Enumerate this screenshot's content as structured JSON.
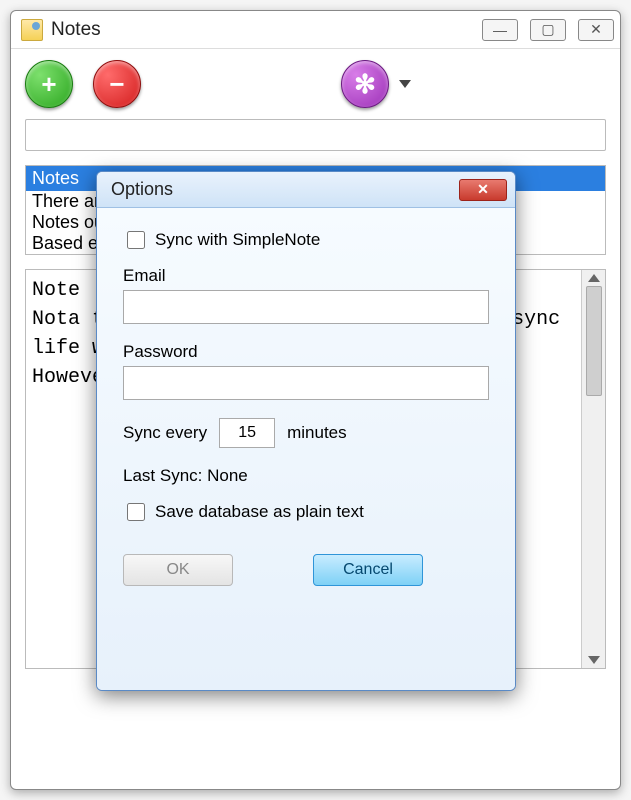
{
  "window": {
    "title": "Notes"
  },
  "toolbar": {
    "add_icon": "+",
    "remove_icon": "−",
    "gear_icon": "✻"
  },
  "search": {
    "value": ""
  },
  "notes_list": {
    "selected_title": "Notes",
    "lines": [
      "There are few t",
      "Notes our no",
      "Based esigne"
    ]
  },
  "note_body": "Note\nNota to m much down Simp my i Then Velo sync\nlife was simplified.\nHowever, at work I am still trapped in",
  "dialog": {
    "title": "Options",
    "sync_checkbox_label": "Sync with SimpleNote",
    "sync_checked": false,
    "email_label": "Email",
    "email_value": "",
    "password_label": "Password",
    "password_value": "",
    "sync_every_label": "Sync every",
    "sync_interval": "15",
    "sync_minutes_label": "minutes",
    "last_sync_label": "Last Sync: None",
    "save_plain_label": "Save database as plain text",
    "save_plain_checked": false,
    "ok_label": "OK",
    "cancel_label": "Cancel"
  }
}
